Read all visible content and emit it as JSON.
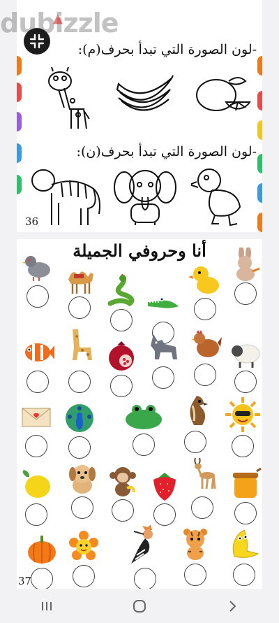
{
  "watermark": {
    "text": "dubizzle"
  },
  "viewer": {
    "collapse_icon": "collapse-icon"
  },
  "page1": {
    "instruction_m": "-لون الصورة التي تبدأ بحرف(م):",
    "instruction_n": "-لون الصورة التي تبدأ بحرف(ن):",
    "page_number": "36",
    "row1": [
      "giraffe",
      "bananas",
      "lemon"
    ],
    "row2": [
      "tiger",
      "elephant",
      "duck"
    ]
  },
  "page2": {
    "title": "أنا وحروفي الجميلة",
    "page_number": "37",
    "rows": [
      [
        "pigeon",
        "camel",
        "snake",
        "crocodile",
        "duckling",
        "rabbit"
      ],
      [
        "clownfish",
        "giraffe",
        "pomegranate",
        "wolf",
        "hen",
        "sheep"
      ],
      [
        "envelope",
        "peacock",
        "frog",
        "falcon",
        "sun"
      ],
      [
        "lemon",
        "puppy",
        "monkey",
        "strawberry",
        "gazelle",
        "honey-jar"
      ],
      [
        "pumpkin",
        "flower",
        "hoopoe",
        "tiger-cub",
        "banana"
      ]
    ]
  },
  "navbar": {
    "recent_icon": "recent-apps-icon",
    "home_icon": "home-icon",
    "back_icon": "back-icon"
  },
  "colors": {
    "accent_green": "#2f8f3a",
    "accent_yellow": "#f3c51f",
    "accent_orange": "#f07a1a"
  }
}
